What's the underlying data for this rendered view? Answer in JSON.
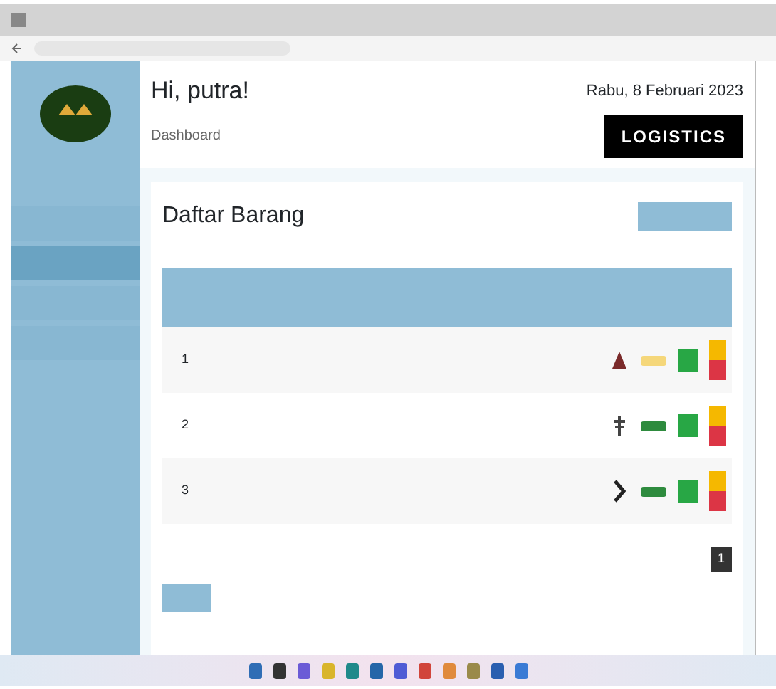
{
  "header": {
    "greeting": "Hi, putra!",
    "date": "Rabu, 8 Februari 2023",
    "logo": "LOGISTICS",
    "breadcrumb": "Dashboard"
  },
  "content": {
    "title": "Daftar Barang",
    "rows": [
      {
        "number": "1",
        "kind": "cone",
        "color": "#f5d77a"
      },
      {
        "number": "2",
        "kind": "plant",
        "color": "#2e8b3e"
      },
      {
        "number": "3",
        "kind": "chevron",
        "color": "#2e8b3e"
      }
    ],
    "pages": [
      {
        "label": "1",
        "selected": true
      }
    ]
  },
  "sidebar": [
    {
      "selected": false
    },
    {
      "selected": true
    },
    {
      "selected": false
    },
    {
      "selected": false
    }
  ]
}
